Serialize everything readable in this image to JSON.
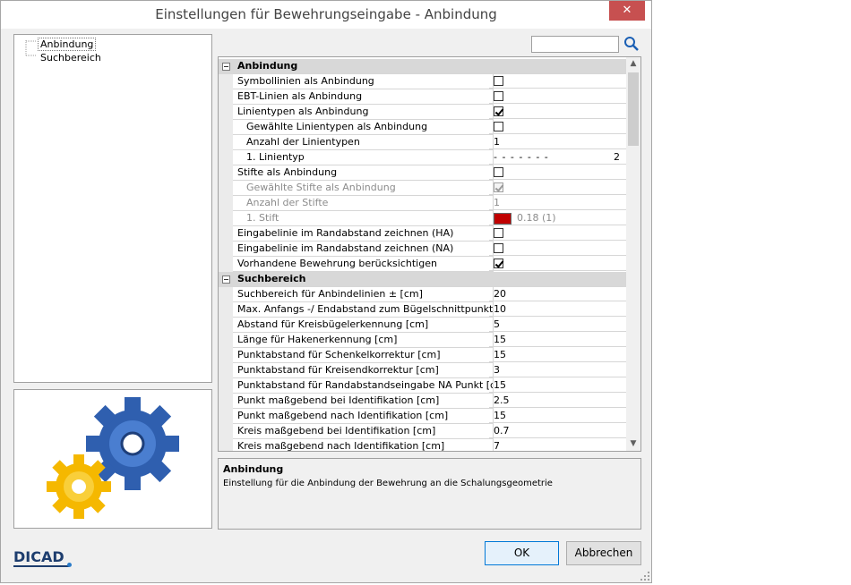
{
  "window": {
    "title": "Einstellungen für Bewehrungseingabe - Anbindung",
    "close_glyph": "✕"
  },
  "tree": {
    "items": [
      "Anbindung",
      "Suchbereich"
    ]
  },
  "search": {
    "value": ""
  },
  "grid": {
    "rows": [
      {
        "type": "category",
        "label": "Anbindung"
      },
      {
        "label": "Symbollinien als Anbindung",
        "checkbox": false
      },
      {
        "label": "EBT-Linien als Anbindung",
        "checkbox": false
      },
      {
        "label": "Linientypen als Anbindung",
        "checkbox": true
      },
      {
        "label": "Gewählte Linientypen als Anbindung",
        "indent": true,
        "checkbox": false
      },
      {
        "label": "Anzahl der Linientypen",
        "indent": true,
        "value": "1"
      },
      {
        "label": "1. Linientyp",
        "indent": true,
        "linetype": true,
        "value": "2"
      },
      {
        "label": "Stifte als Anbindung",
        "checkbox": false
      },
      {
        "label": "Gewählte Stifte als Anbindung",
        "indent": true,
        "disabled": true,
        "checkbox": true
      },
      {
        "label": "Anzahl der Stifte",
        "indent": true,
        "disabled": true,
        "value": "1"
      },
      {
        "label": "1. Stift",
        "indent": true,
        "disabled": true,
        "pen": true,
        "value": "0.18 (1)"
      },
      {
        "label": "Eingabelinie im Randabstand zeichnen (HA)",
        "checkbox": false
      },
      {
        "label": "Eingabelinie im Randabstand zeichnen (NA)",
        "checkbox": false
      },
      {
        "label": "Vorhandene Bewehrung berücksichtigen",
        "checkbox": true
      },
      {
        "type": "category",
        "label": "Suchbereich"
      },
      {
        "label": "Suchbereich für Anbindelinien  ±  [cm]",
        "value": "20"
      },
      {
        "label": "Max. Anfangs -/ Endabstand zum Bügelschnittpunkt [cm]",
        "value": "10"
      },
      {
        "label": "Abstand für  Kreisbügelerkennung [cm]",
        "value": "5"
      },
      {
        "label": "Länge für Hakenerkennung [cm]",
        "value": "15"
      },
      {
        "label": "Punktabstand für Schenkelkorrektur [cm]",
        "value": "15"
      },
      {
        "label": "Punktabstand für Kreisendkorrektur [cm]",
        "value": "3"
      },
      {
        "label": "Punktabstand für Randabstandseingabe NA Punkt [cm]",
        "value": "15"
      },
      {
        "label": "Punkt maßgebend bei Identifikation [cm]",
        "value": "2.5"
      },
      {
        "label": "Punkt maßgebend nach Identifikation [cm]",
        "value": "15"
      },
      {
        "label": "Kreis maßgebend bei Identifikation [cm]",
        "value": "0.7"
      },
      {
        "label": "Kreis maßgebend nach Identifikation [cm]",
        "value": "7"
      }
    ],
    "linetype_dashes": "- - - - - - -",
    "pen_color": "#c00000"
  },
  "description": {
    "title": "Anbindung",
    "text": "Einstellung für die Anbindung der Bewehrung an die Schalungsgeometrie"
  },
  "buttons": {
    "ok": "OK",
    "cancel": "Abbrechen"
  },
  "logo": "DICAD",
  "colors": {
    "accent": "#0078d7",
    "close": "#c75050",
    "gear_blue": "#2f5faf",
    "gear_yellow": "#f5b800"
  }
}
